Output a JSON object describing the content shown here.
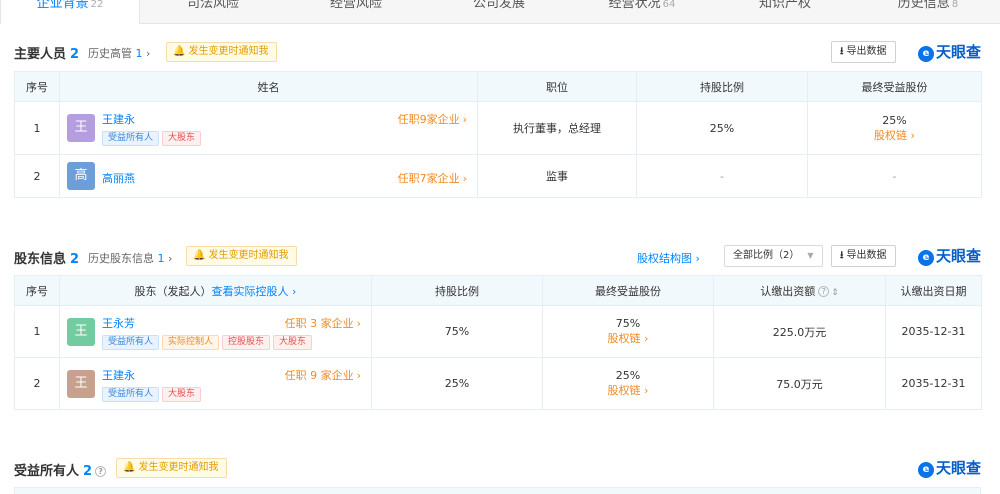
{
  "tabs": [
    {
      "label": "企业背景",
      "count": "22",
      "active": true
    },
    {
      "label": "司法风险",
      "count": ""
    },
    {
      "label": "经营风险",
      "count": ""
    },
    {
      "label": "公司发展",
      "count": ""
    },
    {
      "label": "经营状况",
      "count": "64"
    },
    {
      "label": "知识产权",
      "count": ""
    },
    {
      "label": "历史信息",
      "count": "8"
    }
  ],
  "brand": {
    "name": "天眼查",
    "logo_glyph": "e"
  },
  "export_label": "导出数据",
  "notify_label": "发生变更时通知我",
  "icons": {
    "bell": "bell-icon",
    "download": "download-icon",
    "chevron": "chevron-right-icon",
    "question": "question-icon"
  },
  "colors": {
    "accent": "#0084ff",
    "orange": "#f08a24",
    "header_bg": "#f2f9fc",
    "brand": "#0a5ec8"
  },
  "personnel": {
    "title": "主要人员",
    "count": "2",
    "history_label": "历史高管",
    "history_count": "1",
    "columns": [
      "序号",
      "姓名",
      "职位",
      "持股比例",
      "最终受益股份"
    ],
    "rows": [
      {
        "index": "1",
        "avatar": "王",
        "name": "王建永",
        "serve": "任职9家企业",
        "tags": [
          "受益所有人",
          "大股东"
        ],
        "position": "执行董事，总经理",
        "ratio": "25%",
        "benefit": "25%",
        "benefit_link": "股权链"
      },
      {
        "index": "2",
        "avatar": "高",
        "name": "高丽燕",
        "serve": "任职7家企业",
        "tags": [],
        "position": "监事",
        "ratio": "-",
        "benefit": "-",
        "benefit_link": ""
      }
    ]
  },
  "shareholders": {
    "title": "股东信息",
    "count": "2",
    "history_label": "历史股东信息",
    "history_count": "1",
    "structure_link": "股权结构图",
    "ratio_select": "全部比例（2）",
    "columns": [
      "序号",
      "股东（发起人）",
      "查看实际控股人",
      "持股比例",
      "最终受益股份",
      "认缴出资额",
      "认缴出资日期"
    ],
    "rows": [
      {
        "index": "1",
        "avatar": "王",
        "name": "王永芳",
        "serve": "任职 3 家企业",
        "tags": [
          "受益所有人",
          "实际控制人",
          "控股股东",
          "大股东"
        ],
        "ratio": "75%",
        "benefit": "75%",
        "benefit_link": "股权链",
        "amount": "225.0万元",
        "date": "2035-12-31"
      },
      {
        "index": "2",
        "avatar": "王",
        "name": "王建永",
        "serve": "任职 9 家企业",
        "tags": [
          "受益所有人",
          "大股东"
        ],
        "ratio": "25%",
        "benefit": "25%",
        "benefit_link": "股权链",
        "amount": "75.0万元",
        "date": "2035-12-31"
      }
    ]
  },
  "beneficiaries": {
    "title": "受益所有人",
    "count": "2"
  }
}
